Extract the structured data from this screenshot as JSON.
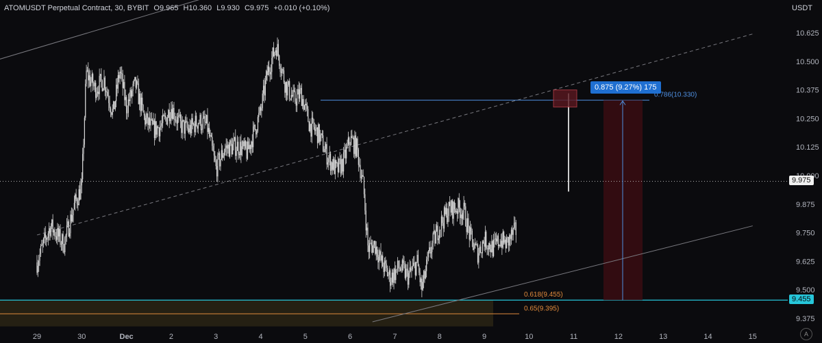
{
  "header": {
    "symbol_line": "ATOMUSDT Perpetual Contract, 30, BYBIT",
    "o_label": "O",
    "o_value": "9.965",
    "h_label": "H",
    "h_value": "10.360",
    "l_label": "L",
    "l_value": "9.930",
    "c_label": "C",
    "c_value": "9.975",
    "change": "+0.010 (+0.10%)"
  },
  "currency": "USDT",
  "auto_label": "A",
  "colors": {
    "background": "#0b0b0e",
    "candle": "#d8d8d8",
    "fib_orange": "#e08a3c",
    "fib_blue": "#4f8fe0",
    "current_tag": "#f0f0f0",
    "support_tag": "#26c6da",
    "measure": "#1f6fd1"
  },
  "measure_text": "0.875 (9.27%) 175",
  "current_price_tag": "9.975",
  "support_price_tag": "9.455",
  "chart_data": {
    "type": "candlestick",
    "y_ticks": [
      "10.625",
      "10.500",
      "10.375",
      "10.250",
      "10.125",
      "10.000",
      "9.875",
      "9.750",
      "9.625",
      "9.500",
      "9.375"
    ],
    "ylim": [
      9.35,
      10.66
    ],
    "x_ticks": [
      "29",
      "30",
      "Dec",
      "2",
      "3",
      "4",
      "5",
      "6",
      "7",
      "8",
      "9",
      "10",
      "11",
      "12",
      "13",
      "14",
      "15"
    ],
    "close_path": [
      [
        0.0,
        9.62
      ],
      [
        0.3,
        9.78
      ],
      [
        0.6,
        9.7
      ],
      [
        0.85,
        9.88
      ],
      [
        1.0,
        9.95
      ],
      [
        1.1,
        10.45
      ],
      [
        1.3,
        10.38
      ],
      [
        1.5,
        10.42
      ],
      [
        1.7,
        10.27
      ],
      [
        1.85,
        10.46
      ],
      [
        2.0,
        10.3
      ],
      [
        2.2,
        10.4
      ],
      [
        2.4,
        10.25
      ],
      [
        2.6,
        10.2
      ],
      [
        2.8,
        10.22
      ],
      [
        3.0,
        10.3
      ],
      [
        3.2,
        10.22
      ],
      [
        3.4,
        10.2
      ],
      [
        3.6,
        10.24
      ],
      [
        3.8,
        10.22
      ],
      [
        4.0,
        10.03
      ],
      [
        4.2,
        10.12
      ],
      [
        4.5,
        10.13
      ],
      [
        4.7,
        10.1
      ],
      [
        4.9,
        10.22
      ],
      [
        5.0,
        10.28
      ],
      [
        5.15,
        10.45
      ],
      [
        5.35,
        10.57
      ],
      [
        5.55,
        10.4
      ],
      [
        5.75,
        10.33
      ],
      [
        5.9,
        10.36
      ],
      [
        6.1,
        10.22
      ],
      [
        6.3,
        10.18
      ],
      [
        6.5,
        10.08
      ],
      [
        6.7,
        10.02
      ],
      [
        6.85,
        10.06
      ],
      [
        7.0,
        10.16
      ],
      [
        7.15,
        10.12
      ],
      [
        7.3,
        9.95
      ],
      [
        7.4,
        9.68
      ],
      [
        7.55,
        9.7
      ],
      [
        7.7,
        9.62
      ],
      [
        7.9,
        9.55
      ],
      [
        8.1,
        9.6
      ],
      [
        8.3,
        9.56
      ],
      [
        8.5,
        9.62
      ],
      [
        8.6,
        9.5
      ],
      [
        8.8,
        9.68
      ],
      [
        9.0,
        9.78
      ],
      [
        9.2,
        9.85
      ],
      [
        9.4,
        9.86
      ],
      [
        9.55,
        9.84
      ],
      [
        9.7,
        9.72
      ],
      [
        9.85,
        9.66
      ],
      [
        10.0,
        9.72
      ],
      [
        10.2,
        9.68
      ],
      [
        10.35,
        9.72
      ],
      [
        10.5,
        9.7
      ],
      [
        10.62,
        9.74
      ],
      [
        10.72,
        9.76
      ],
      [
        10.75,
        9.98
      ],
      [
        10.78,
        10.3
      ],
      [
        10.8,
        9.975
      ]
    ],
    "current_price": 9.975,
    "fib_levels": [
      {
        "ratio": "0.786",
        "price": 10.33,
        "label": "0.786(10.330)"
      },
      {
        "ratio": "0.618",
        "price": 9.455,
        "label": "0.618(9.455)"
      },
      {
        "ratio": "0.65",
        "price": 9.395,
        "label": "0.65(9.395)"
      }
    ],
    "measure": {
      "from_price": 9.455,
      "to_price": 10.33,
      "change": 0.875,
      "percent": "9.27%",
      "bars": 175
    },
    "trend_lines": [
      {
        "style": "solid",
        "from": [
          -1.0,
          10.5
        ],
        "to": [
          11.0,
          11.2
        ]
      },
      {
        "style": "dashed",
        "from": [
          0.0,
          9.74
        ],
        "to": [
          16.0,
          10.62
        ]
      },
      {
        "style": "solid",
        "from": [
          7.5,
          9.36
        ],
        "to": [
          16.0,
          9.78
        ]
      }
    ]
  }
}
